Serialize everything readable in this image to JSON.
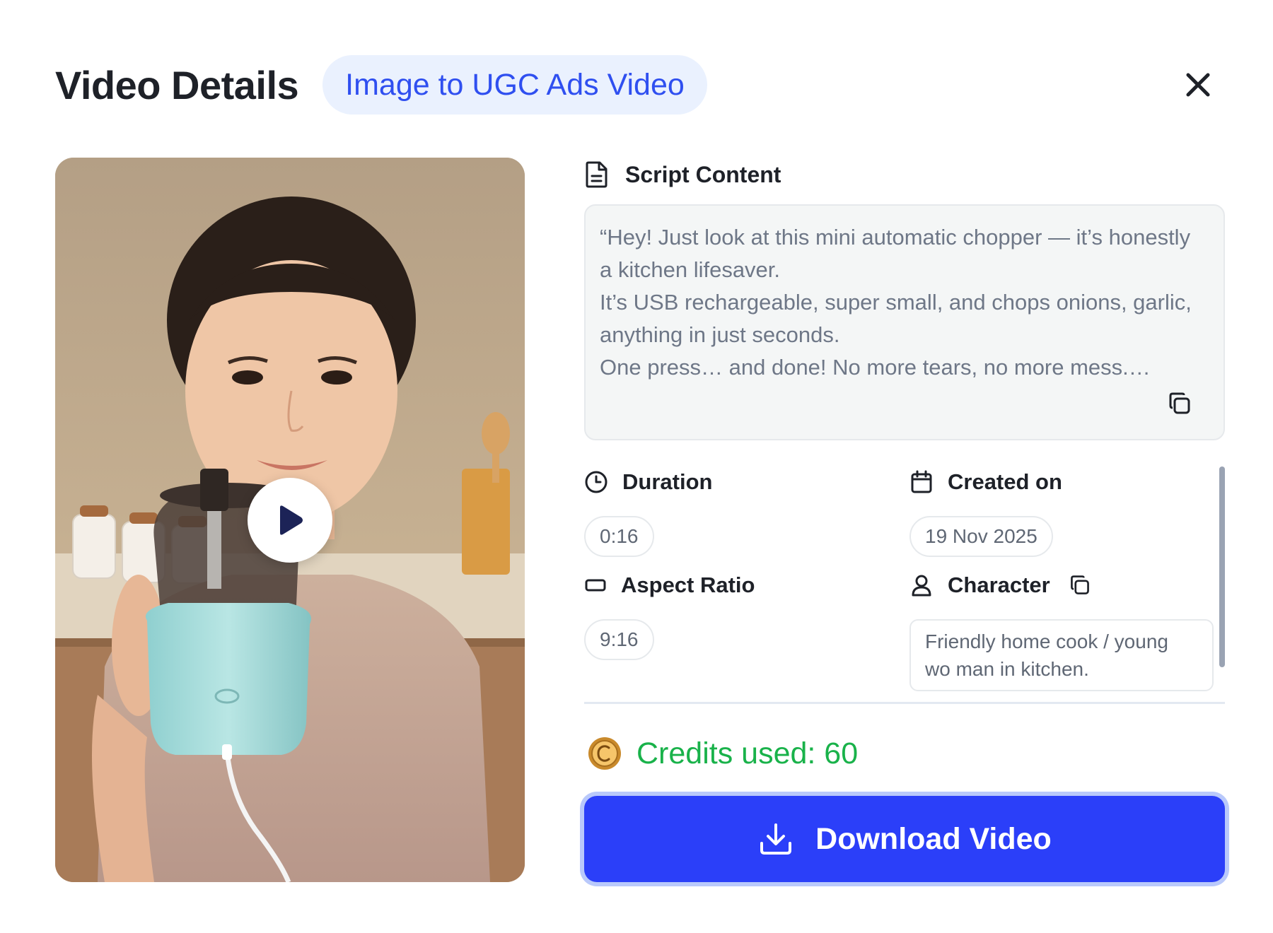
{
  "header": {
    "title": "Video Details",
    "tag": "Image to UGC Ads Video"
  },
  "icons": {
    "close": "close-icon",
    "play": "play-icon",
    "script": "document-icon",
    "copy": "copy-icon",
    "duration": "clock-icon",
    "created": "calendar-icon",
    "aspect": "rectangle-icon",
    "character": "user-icon",
    "credits": "coin-icon",
    "download": "download-icon"
  },
  "script": {
    "label": "Script Content",
    "text": "“Hey! Just look at this mini automatic chopper — it’s honestly\na kitchen lifesaver.\nIt’s USB rechargeable, super small, and chops onions, garlic,\nanything in just seconds.\nOne press… and done! No more tears, no more mess.…"
  },
  "meta": {
    "duration": {
      "label": "Duration",
      "value": "0:16"
    },
    "created": {
      "label": "Created on",
      "value": "19 Nov 2025"
    },
    "aspect": {
      "label": "Aspect Ratio",
      "value": "9:16"
    },
    "character": {
      "label": "Character",
      "value": "Friendly home cook / young wo man in kitchen."
    }
  },
  "credits": {
    "text": "Credits used: 60"
  },
  "actions": {
    "download_label": "Download Video"
  },
  "colors": {
    "accent": "#2b3ff9",
    "tag_bg": "#eaf1fe",
    "tag_text": "#2f4ff0",
    "credits_green": "#19b24a"
  }
}
